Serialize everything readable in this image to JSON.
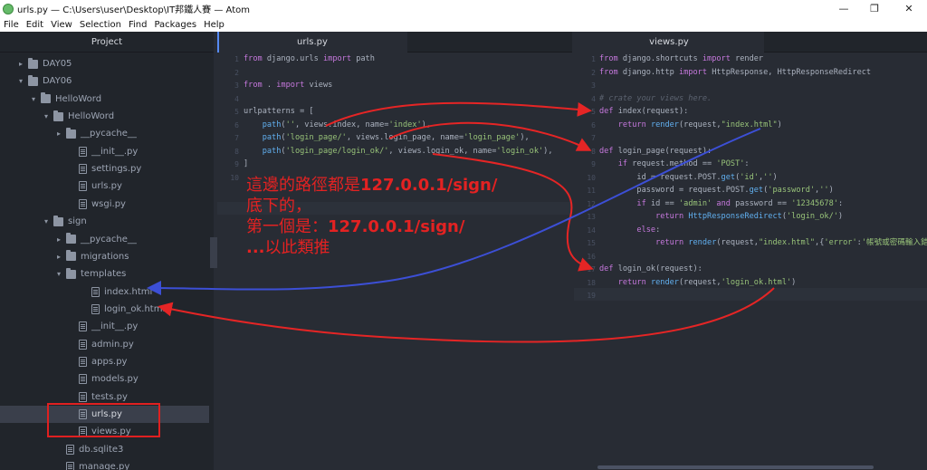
{
  "window": {
    "title": "urls.py — C:\\Users\\user\\Desktop\\IT邦鐵人賽 — Atom",
    "minimize": "—",
    "restore": "❐",
    "close": "✕"
  },
  "menu": [
    "File",
    "Edit",
    "View",
    "Selection",
    "Find",
    "Packages",
    "Help"
  ],
  "tree": {
    "title": "Project",
    "items": [
      {
        "label": "DAY05",
        "type": "folder",
        "open": false
      },
      {
        "label": "DAY06",
        "type": "folder",
        "open": true
      },
      {
        "label": "HelloWord",
        "type": "folder",
        "open": true
      },
      {
        "label": "HelloWord",
        "type": "folder",
        "open": true
      },
      {
        "label": "__pycache__",
        "type": "folder",
        "open": false
      },
      {
        "label": "__init__.py",
        "type": "file"
      },
      {
        "label": "settings.py",
        "type": "file"
      },
      {
        "label": "urls.py",
        "type": "file"
      },
      {
        "label": "wsgi.py",
        "type": "file"
      },
      {
        "label": "sign",
        "type": "folder",
        "open": true
      },
      {
        "label": "__pycache__",
        "type": "folder",
        "open": false
      },
      {
        "label": "migrations",
        "type": "folder",
        "open": false
      },
      {
        "label": "templates",
        "type": "folder",
        "open": true
      },
      {
        "label": "index.html",
        "type": "file"
      },
      {
        "label": "login_ok.html",
        "type": "file"
      },
      {
        "label": "__init__.py",
        "type": "file"
      },
      {
        "label": "admin.py",
        "type": "file"
      },
      {
        "label": "apps.py",
        "type": "file"
      },
      {
        "label": "models.py",
        "type": "file"
      },
      {
        "label": "tests.py",
        "type": "file"
      },
      {
        "label": "urls.py",
        "type": "file",
        "selected": true
      },
      {
        "label": "views.py",
        "type": "file"
      },
      {
        "label": "db.sqlite3",
        "type": "file"
      },
      {
        "label": "manage.py",
        "type": "file"
      }
    ]
  },
  "left_editor": {
    "tab": "urls.py",
    "line_numbers": [
      "1",
      "2",
      "3",
      "4",
      "5",
      "6",
      "7",
      "8",
      "9",
      "10"
    ],
    "lines": [
      "from django.urls import path",
      "",
      "from . import views",
      "",
      "urlpatterns = [",
      "    path('', views.index, name='index'),",
      "    path('login_page/', views.login_page, name='login_page'),",
      "    path('login_page/login_ok/', views.login_ok, name='login_ok'),",
      "]",
      ""
    ]
  },
  "right_editor": {
    "tab": "views.py",
    "line_numbers": [
      "1",
      "2",
      "3",
      "4",
      "5",
      "6",
      "7",
      "8",
      "9",
      "10",
      "11",
      "12",
      "13",
      "14",
      "15",
      "16",
      "17",
      "18",
      "19"
    ],
    "lines": [
      "from django.shortcuts import render",
      "from django.http import HttpResponse, HttpResponseRedirect",
      "",
      "# crate your views here.",
      "def index(request):",
      "    return render(request,\"index.html\")",
      "",
      "def login_page(request):",
      "    if request.method == 'POST':",
      "        id = request.POST.get('id','')",
      "        password = request.POST.get('password','')",
      "        if id == 'admin' and password == '12345678':",
      "            return HttpResponseRedirect('login_ok/')",
      "        else:",
      "            return render(request,\"index.html\",{'error':'帳號或密碼輸入錯誤'})",
      "",
      "def login_ok(request):",
      "    return render(request,'login_ok.html')",
      ""
    ]
  },
  "annotation": {
    "line1_prefix": "這邊的路徑都是",
    "line1_bold": "127.0.0.1/sign/",
    "line2": "底下的，",
    "line3_prefix": "第一個是：",
    "line3_bold": "127.0.0.1/sign/",
    "line4_bold": "...",
    "line4_suffix": "以此類推"
  },
  "colors": {
    "arrow_red": "#e52525",
    "arrow_blue": "#3c4fd6",
    "highlight_box": "#e02020"
  }
}
